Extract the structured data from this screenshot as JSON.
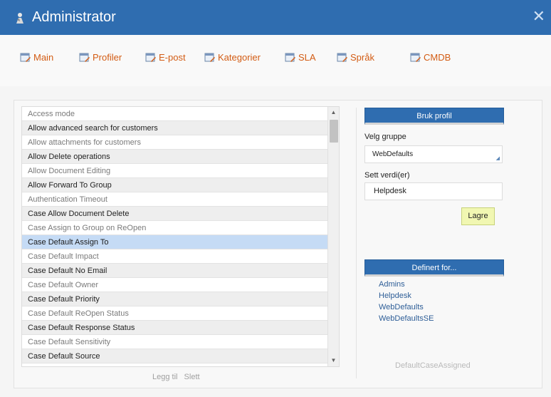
{
  "window": {
    "title": "Administrator",
    "close_label": "✕"
  },
  "nav": {
    "items": [
      {
        "label": "Main"
      },
      {
        "label": "Profiler"
      },
      {
        "label": "E-post"
      },
      {
        "label": "Kategorier"
      },
      {
        "label": "SLA"
      },
      {
        "label": "Språk"
      },
      {
        "label": "CMDB"
      }
    ]
  },
  "list": {
    "items": [
      "Access mode",
      "Allow advanced search for customers",
      "Allow attachments for customers",
      "Allow Delete operations",
      "Allow Document Editing",
      "Allow Forward To Group",
      "Authentication Timeout",
      "Case Allow Document Delete",
      "Case Assign to Group on ReOpen",
      "Case Default Assign To",
      "Case Default Impact",
      "Case Default No Email",
      "Case Default Owner",
      "Case Default Priority",
      "Case Default ReOpen Status",
      "Case Default Response Status",
      "Case Default Sensitivity",
      "Case Default Source"
    ],
    "selected_label": "Case Default Assign To",
    "actions": {
      "add": "Legg til",
      "delete": "Slett"
    }
  },
  "panel": {
    "apply_profile_label": "Bruk profil",
    "group_label": "Velg gruppe",
    "group_value": "WebDefaults",
    "value_label": "Sett verdi(er)",
    "value": "Helpdesk",
    "save_label": "Lagre",
    "defined_for_label": "Definert for...",
    "defined_for": [
      "Admins",
      "Helpdesk",
      "WebDefaults",
      "WebDefaultsSE"
    ],
    "footer_value": "DefaultCaseAssigned"
  },
  "colors": {
    "titlebar": "#2f6db0",
    "nav_link": "#d35c14",
    "selected_row": "#c5dbf5",
    "save_button": "#f1f7b2",
    "defined_link": "#2e5e97"
  }
}
